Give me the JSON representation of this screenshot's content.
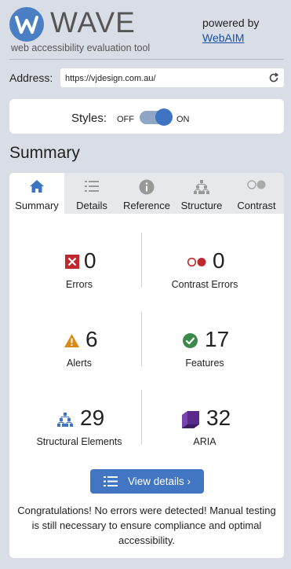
{
  "header": {
    "logo_text": "WAVE",
    "tagline": "web accessibility evaluation tool",
    "powered_by": "powered by",
    "webaim_link": "WebAIM"
  },
  "address": {
    "label": "Address:",
    "value": "https://vjdesign.com.au/"
  },
  "styles": {
    "label": "Styles:",
    "off": "OFF",
    "on": "ON",
    "state": "on"
  },
  "summary_title": "Summary",
  "tabs": [
    {
      "label": "Summary",
      "icon": "home-icon",
      "active": true
    },
    {
      "label": "Details",
      "icon": "list-icon",
      "active": false
    },
    {
      "label": "Reference",
      "icon": "info-icon",
      "active": false
    },
    {
      "label": "Structure",
      "icon": "hierarchy-icon",
      "active": false
    },
    {
      "label": "Contrast",
      "icon": "contrast-icon",
      "active": false
    }
  ],
  "stats": {
    "errors": {
      "value": "0",
      "label": "Errors"
    },
    "contrast_errors": {
      "value": "0",
      "label": "Contrast Errors"
    },
    "alerts": {
      "value": "6",
      "label": "Alerts"
    },
    "features": {
      "value": "17",
      "label": "Features"
    },
    "structural": {
      "value": "29",
      "label": "Structural Elements"
    },
    "aria": {
      "value": "32",
      "label": "ARIA"
    }
  },
  "view_details": "View details ›",
  "congrats": "Congratulations! No errors were detected! Manual testing is still necessary to ensure compliance and optimal accessibility.",
  "colors": {
    "accent": "#4276c3",
    "error": "#c0282d",
    "alert": "#d98a14",
    "feature": "#3b8a4a",
    "aria": "#5a2a8a"
  }
}
